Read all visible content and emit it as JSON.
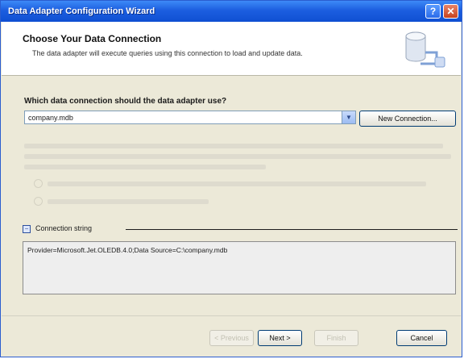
{
  "window": {
    "title": "Data Adapter Configuration Wizard",
    "help_glyph": "?",
    "close_glyph": "✕"
  },
  "header": {
    "title": "Choose Your Data Connection",
    "subtitle": "The data adapter will execute queries using this connection to load and update data."
  },
  "connection": {
    "question": "Which data connection should the data adapter use?",
    "selected": "company.mdb",
    "new_button": "New Connection..."
  },
  "connection_string": {
    "label": "Connection string",
    "value": "Provider=Microsoft.Jet.OLEDB.4.0;Data Source=C:\\company.mdb"
  },
  "buttons": {
    "previous": "< Previous",
    "next": "Next >",
    "finish": "Finish",
    "cancel": "Cancel"
  },
  "colors": {
    "titlebar": "#0f4fd2",
    "dialog_bg": "#ece9d8",
    "header_bg": "#ffffff"
  }
}
